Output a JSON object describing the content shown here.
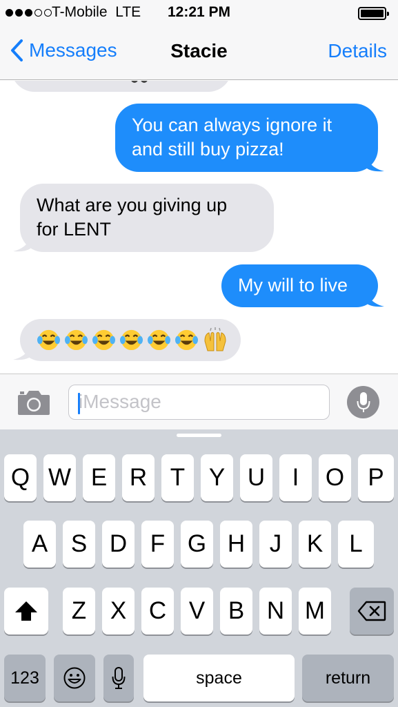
{
  "status_bar": {
    "carrier": "T-Mobile",
    "network": "LTE",
    "time": "12:21 PM",
    "signal_bars": 3,
    "signal_total": 5,
    "battery_level": 1.0
  },
  "nav": {
    "back_label": "Messages",
    "title": "Stacie",
    "details_label": "Details",
    "accent_color": "#157efb"
  },
  "messages": [
    {
      "from": "me",
      "text_lines": [
        "You can always ignore it",
        "and still buy pizza!"
      ]
    },
    {
      "from": "them",
      "text_lines": [
        "What are you giving up",
        "for LENT"
      ]
    },
    {
      "from": "me",
      "text_lines": [
        "My will to live"
      ]
    },
    {
      "from": "them",
      "emoji": [
        "face-with-tears-of-joy",
        "face-with-tears-of-joy",
        "face-with-tears-of-joy",
        "face-with-tears-of-joy",
        "face-with-tears-of-joy",
        "face-with-tears-of-joy",
        "raising-hands"
      ]
    }
  ],
  "bubble_colors": {
    "outgoing": "#1e8dfb",
    "incoming": "#e5e5ea"
  },
  "composer": {
    "placeholder": "iMessage",
    "value": "",
    "camera_icon": "camera-icon",
    "mic_icon": "microphone-icon"
  },
  "keyboard": {
    "row1": [
      "Q",
      "W",
      "E",
      "R",
      "T",
      "Y",
      "U",
      "I",
      "O",
      "P"
    ],
    "row2": [
      "A",
      "S",
      "D",
      "F",
      "G",
      "H",
      "J",
      "K",
      "L"
    ],
    "row3": [
      "Z",
      "X",
      "C",
      "V",
      "B",
      "N",
      "M"
    ],
    "shift_icon": "shift-arrow-icon",
    "delete_icon": "backspace-icon",
    "numbers_label": "123",
    "emoji_icon": "emoji-smiley-icon",
    "dictation_icon": "microphone-icon",
    "space_label": "space",
    "return_label": "return"
  }
}
